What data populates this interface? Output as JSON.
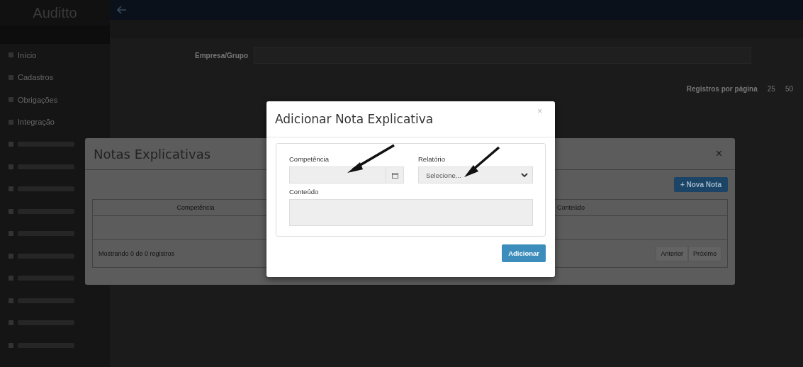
{
  "app": {
    "logo": "Auditto"
  },
  "sidebar": {
    "items": [
      {
        "label": "Início",
        "selected": false
      },
      {
        "label": "Cadastros",
        "selected": false
      },
      {
        "label": "Obrigações",
        "selected": false
      },
      {
        "label": "Integração",
        "selected": false
      },
      {
        "selected": false
      },
      {
        "selected": false
      },
      {
        "selected": false
      },
      {
        "selected": false
      },
      {
        "selected": false
      },
      {
        "selected": false
      },
      {
        "selected": false
      },
      {
        "selected": false
      },
      {
        "selected": false
      },
      {
        "selected": false
      }
    ]
  },
  "filters": {
    "company_label": "Empresa/Grupo",
    "per_page_label": "Registros por página",
    "per_page_options": [
      "25",
      "50"
    ]
  },
  "notes_modal": {
    "title": "Notas Explicativas",
    "close": "×",
    "new_button": "+ Nova Nota",
    "columns": [
      "Competência",
      "Conteúdo"
    ],
    "footer": "Mostrando 0 de 0 registros",
    "pager": [
      "Anterior",
      "Próximo"
    ]
  },
  "add_modal": {
    "title": "Adicionar Nota Explicativa",
    "close": "×",
    "fields": [
      {
        "kind": "date",
        "label": "Competência"
      },
      {
        "kind": "select",
        "label": "Relatório",
        "value": "Selecione..."
      },
      {
        "kind": "textarea",
        "label": "Conteúdo"
      }
    ],
    "submit": "Adicionar"
  }
}
